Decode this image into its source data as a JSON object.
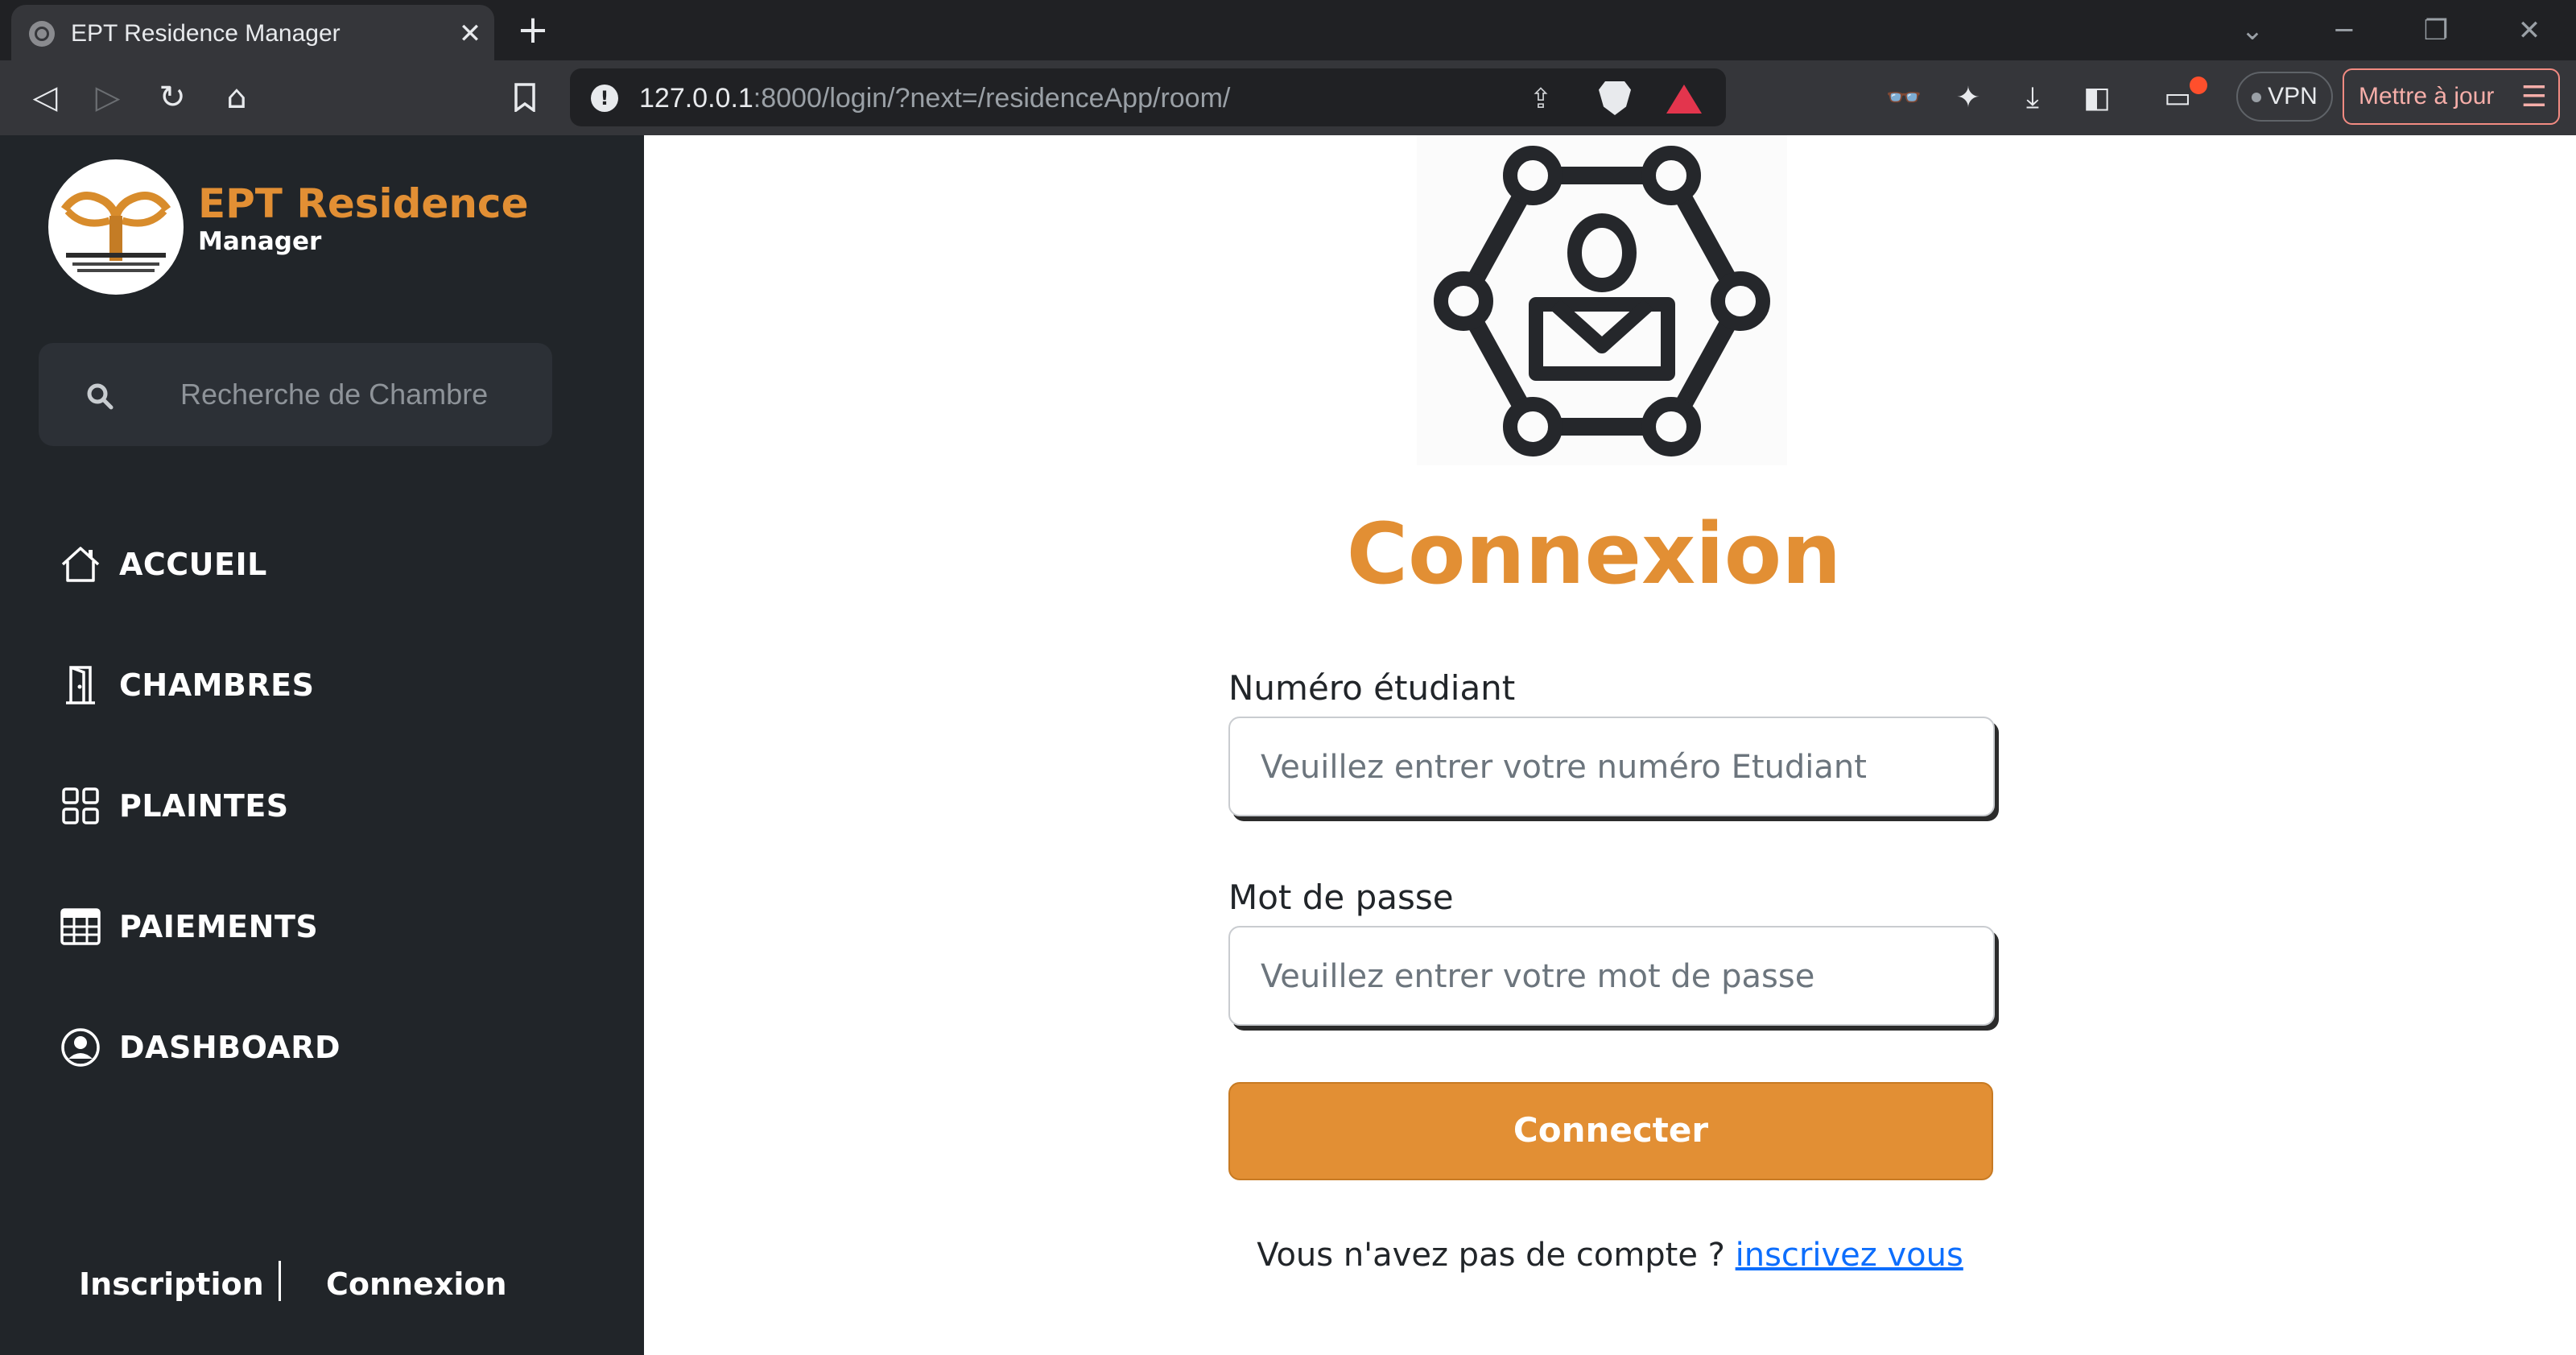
{
  "browser": {
    "tab_title": "EPT Residence Manager",
    "url_host": "127.0.0.1",
    "url_path": ":8000/login/?next=/residenceApp/room/",
    "vpn_label": "VPN",
    "update_label": "Mettre à jour"
  },
  "sidebar": {
    "brand_name": "EPT Residence",
    "brand_sub": "Manager",
    "search_placeholder": "Recherche de Chambre",
    "items": [
      {
        "label": "ACCUEIL",
        "icon": "home-icon"
      },
      {
        "label": "CHAMBRES",
        "icon": "door-icon"
      },
      {
        "label": "PLAINTES",
        "icon": "grid-icon"
      },
      {
        "label": "PAIEMENTS",
        "icon": "table-icon"
      },
      {
        "label": "DASHBOARD",
        "icon": "user-circle-icon"
      }
    ],
    "footer": {
      "signup": "Inscription",
      "login": "Connexion"
    }
  },
  "login": {
    "title": "Connexion",
    "student_label": "Numéro étudiant",
    "student_placeholder": "Veuillez entrer votre numéro Etudiant",
    "password_label": "Mot de passe",
    "password_placeholder": "Veuillez entrer votre mot de passe",
    "submit": "Connecter",
    "no_account": "Vous n'avez pas de compte ? ",
    "signup_link": "inscrivez vous"
  },
  "colors": {
    "accent": "#e28f34",
    "sidebar_bg": "#212529",
    "link": "#0d6efd"
  }
}
